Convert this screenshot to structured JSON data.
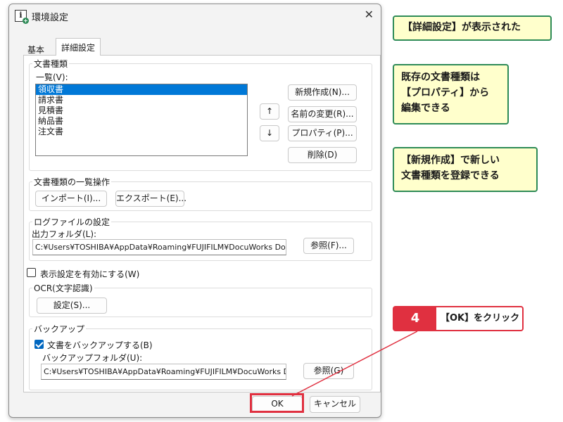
{
  "window": {
    "title": "環境設定",
    "close_glyph": "✕"
  },
  "tabs": [
    {
      "label": "基本"
    },
    {
      "label": "詳細設定"
    }
  ],
  "doc_types": {
    "title": "文書種類",
    "list_label": "一覧(V):",
    "items": [
      "領収書",
      "請求書",
      "見積書",
      "納品書",
      "注文書"
    ],
    "selected_index": 0,
    "up_glyph": "↑",
    "down_glyph": "↓",
    "new_button": "新規作成(N)...",
    "rename_button": "名前の変更(R)...",
    "properties_button": "プロパティ(P)...",
    "delete_button": "削除(D)"
  },
  "list_ops": {
    "title": "文書種類の一覧操作",
    "import_button": "インポート(I)...",
    "export_button": "エクスポート(E)..."
  },
  "log": {
    "title": "ログファイルの設定",
    "folder_label": "出力フォルダ(L):",
    "folder_value": "C:¥Users¥TOSHIBA¥AppData¥Roaming¥FUJIFILM¥DocuWorks Docu",
    "browse_button": "参照(F)..."
  },
  "display_setting": {
    "label": "表示設定を有効にする(W)",
    "checked": false
  },
  "ocr": {
    "title": "OCR(文字認識)",
    "settings_button": "設定(S)..."
  },
  "backup": {
    "title": "バックアップ",
    "checkbox_label": "文書をバックアップする(B)",
    "checked": true,
    "folder_label": "バックアップフォルダ(U):",
    "folder_value": "C:¥Users¥TOSHIBA¥AppData¥Roaming¥FUJIFILM¥DocuWorks Doc",
    "browse_button": "参照(G)"
  },
  "footer": {
    "ok_button": "OK",
    "cancel_button": "キャンセル"
  },
  "callouts": [
    {
      "lines": [
        "【詳細設定】が表示された"
      ]
    },
    {
      "lines": [
        "既存の文書種類は",
        "【プロパティ】から",
        "編集できる"
      ]
    },
    {
      "lines": [
        "【新規作成】で新しい",
        "文書種類を登録できる"
      ]
    }
  ],
  "step": {
    "number": "4",
    "text": "【OK】をクリック"
  },
  "colors": {
    "callout_border": "#2e8b57",
    "callout_fill": "#ffffcc",
    "step_red": "#e03040",
    "selection": "#0078d7"
  }
}
